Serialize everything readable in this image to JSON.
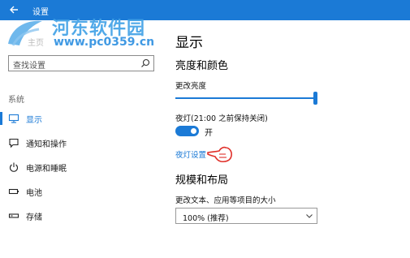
{
  "window": {
    "title": "设置"
  },
  "watermark": {
    "title": "河东软件园",
    "url": "www.pc0359.cn"
  },
  "sidebar": {
    "home_label": "主页",
    "search_placeholder": "查找设置",
    "group_label": "系统",
    "items": [
      {
        "label": "显示",
        "icon": "monitor-icon",
        "active": true
      },
      {
        "label": "通知和操作",
        "icon": "notification-icon",
        "active": false
      },
      {
        "label": "电源和睡眠",
        "icon": "power-icon",
        "active": false
      },
      {
        "label": "电池",
        "icon": "battery-icon",
        "active": false
      },
      {
        "label": "存储",
        "icon": "storage-icon",
        "active": false
      }
    ]
  },
  "main": {
    "title": "显示",
    "brightness_section": "亮度和颜色",
    "brightness_label": "更改亮度",
    "brightness_level": 1.0,
    "night_light_label": "夜灯(21:00 之前保持关闭)",
    "night_light_state": "开",
    "night_light_link": "夜灯设置",
    "layout_section": "规模和布局",
    "scale_label": "更改文本、应用等项目的大小",
    "scale_value": "100% (推荐)"
  },
  "colors": {
    "accent": "#1b7ad6",
    "titlebar": "#1b7ad6"
  }
}
